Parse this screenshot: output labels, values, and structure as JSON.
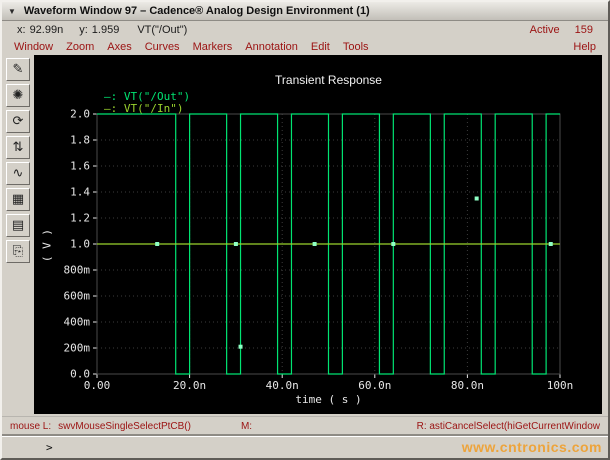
{
  "window": {
    "title": "Waveform Window 97 – Cadence® Analog Design Environment (1)",
    "active_label": "Active",
    "active_value": "159"
  },
  "readout": {
    "x_label": "x:",
    "x_value": "92.99n",
    "y_label": "y:",
    "y_value": "1.959",
    "trace": "VT(\"/Out\")"
  },
  "menu": {
    "items": [
      "Window",
      "Zoom",
      "Axes",
      "Curves",
      "Markers",
      "Annotation",
      "Edit",
      "Tools"
    ],
    "help": "Help"
  },
  "toolbar": {
    "icons": [
      {
        "name": "pen-tool-icon",
        "glyph": "✎"
      },
      {
        "name": "starburst-icon",
        "glyph": "✺"
      },
      {
        "name": "refresh-icon",
        "glyph": "⟳"
      },
      {
        "name": "fit-vertical-icon",
        "glyph": "⇅"
      },
      {
        "name": "waveform-zoom-icon",
        "glyph": "∿"
      },
      {
        "name": "calculator-icon",
        "glyph": "▦"
      },
      {
        "name": "strip-chart-icon",
        "glyph": "▤"
      },
      {
        "name": "copy-window-icon",
        "glyph": "⎘"
      }
    ]
  },
  "statusbar": {
    "mouse_l_label": "mouse L:",
    "mouse_l_value": "swvMouseSingleSelectPtCB()",
    "m_label": "M:",
    "right": "R: astiCancelSelect(hiGetCurrentWindow"
  },
  "prompt": ">",
  "watermark": "www.cntronics.com",
  "colors": {
    "chrome": "#d4d0c8",
    "menu_text": "#9b1212",
    "plot_bg": "#000000",
    "grid": "#3c3c3c",
    "frame": "#4a4a4a",
    "tick_text": "#e6e6e6",
    "marker": "#8effc4",
    "watermark": "#eda43c"
  },
  "chart_data": {
    "type": "line",
    "title": "Transient Response",
    "xlabel": "time ( s )",
    "ylabel": "( V )",
    "x_unit": "ns",
    "xlim": [
      0,
      100
    ],
    "ylim": [
      0,
      2
    ],
    "grid": "dotted",
    "legend_position": "top-left",
    "xticks": [
      {
        "ns": 0,
        "label": "0.00"
      },
      {
        "ns": 20,
        "label": "20.0n"
      },
      {
        "ns": 40,
        "label": "40.0n"
      },
      {
        "ns": 60,
        "label": "60.0n"
      },
      {
        "ns": 80,
        "label": "80.0n"
      },
      {
        "ns": 100,
        "label": "100n"
      }
    ],
    "yticks": [
      {
        "v": 2.0,
        "label": "2.0"
      },
      {
        "v": 1.8,
        "label": "1.8"
      },
      {
        "v": 1.6,
        "label": "1.6"
      },
      {
        "v": 1.4,
        "label": "1.4"
      },
      {
        "v": 1.2,
        "label": "1.2"
      },
      {
        "v": 1.0,
        "label": "1.0"
      },
      {
        "v": 0.8,
        "label": "800m"
      },
      {
        "v": 0.6,
        "label": "600m"
      },
      {
        "v": 0.4,
        "label": "400m"
      },
      {
        "v": 0.2,
        "label": "200m"
      },
      {
        "v": 0.0,
        "label": "0.0"
      }
    ],
    "series": [
      {
        "name": "VT(\"/Out\")",
        "color": "#00e472",
        "kind": "pulse",
        "low": 0.0,
        "high": 2.0,
        "high_intervals_ns": [
          [
            0,
            17
          ],
          [
            20,
            28
          ],
          [
            31,
            39
          ],
          [
            42,
            50
          ],
          [
            53,
            61
          ],
          [
            64,
            72
          ],
          [
            75,
            83
          ],
          [
            86,
            94
          ],
          [
            97,
            100
          ]
        ]
      },
      {
        "name": "VT(\"/In\")",
        "color": "#9ad22d",
        "kind": "constant",
        "value": 1.0
      }
    ],
    "markers": [
      {
        "ns": 13,
        "v": 1.0
      },
      {
        "ns": 30,
        "v": 1.0
      },
      {
        "ns": 47,
        "v": 1.0
      },
      {
        "ns": 64,
        "v": 1.0
      },
      {
        "ns": 98,
        "v": 1.0
      },
      {
        "ns": 82,
        "v": 1.35
      },
      {
        "ns": 31,
        "v": 0.21
      }
    ]
  }
}
